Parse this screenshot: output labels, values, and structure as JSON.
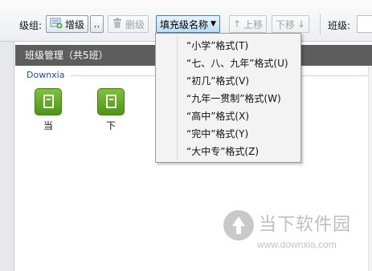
{
  "toolbar": {
    "grade_group_label": "级组:",
    "add_grade_label": "增级",
    "more_label": "..",
    "delete_grade_label": "删级",
    "fill_name_label": "填充级名称",
    "move_up_label": "上移",
    "move_down_label": "下移",
    "class_label": "班级:"
  },
  "panel": {
    "title": "班级管理（共5班）",
    "group_name": "Downxia"
  },
  "grades": [
    {
      "label": "当",
      "icon": "green-document-icon"
    },
    {
      "label": "下",
      "icon": "green-document-icon"
    }
  ],
  "menu": {
    "items": [
      "“小学”格式(T)",
      "“七、八、九年”格式(U)",
      "“初几”格式(V)",
      "“九年一贯制”格式(W)",
      "“高中”格式(X)",
      "“完中”格式(Y)",
      "“大中专”格式(Z)"
    ]
  },
  "watermark": {
    "title": "当下软件园",
    "url": "www.downxia.com"
  },
  "colors": {
    "panel_header": "#5d5d5d",
    "tile_green": "#6bb02a",
    "group_title": "#1b4fa0",
    "active_button": "#bcdcf4"
  }
}
